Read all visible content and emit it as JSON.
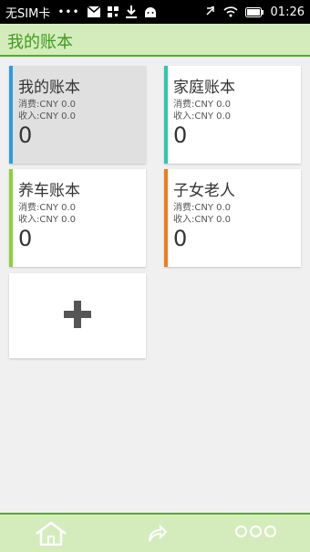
{
  "status_bar": {
    "carrier": "无SIM卡",
    "dots": "•••",
    "time": "01:26"
  },
  "app": {
    "title": "我的账本"
  },
  "books": [
    {
      "name": "我的账本",
      "expense": "消费:CNY 0.0",
      "income": "收入:CNY 0.0",
      "count": "0",
      "accent": "#2c9de0"
    },
    {
      "name": "家庭账本",
      "expense": "消费:CNY 0.0",
      "income": "收入:CNY 0.0",
      "count": "0",
      "accent": "#2ec7ae"
    },
    {
      "name": "养车账本",
      "expense": "消费:CNY 0.0",
      "income": "收入:CNY 0.0",
      "count": "0",
      "accent": "#8cd13a"
    },
    {
      "name": "子女老人",
      "expense": "消费:CNY 0.0",
      "income": "收入:CNY 0.0",
      "count": "0",
      "accent": "#f07a1f"
    }
  ],
  "add_button": {
    "icon": "plus-icon"
  },
  "bottom_nav": {
    "items": [
      "home-icon",
      "share-icon",
      "more-icon"
    ]
  },
  "colors": {
    "header_bg": "#d4ecbb",
    "header_line": "#4caf2c",
    "title_text": "#3f9a1f"
  }
}
